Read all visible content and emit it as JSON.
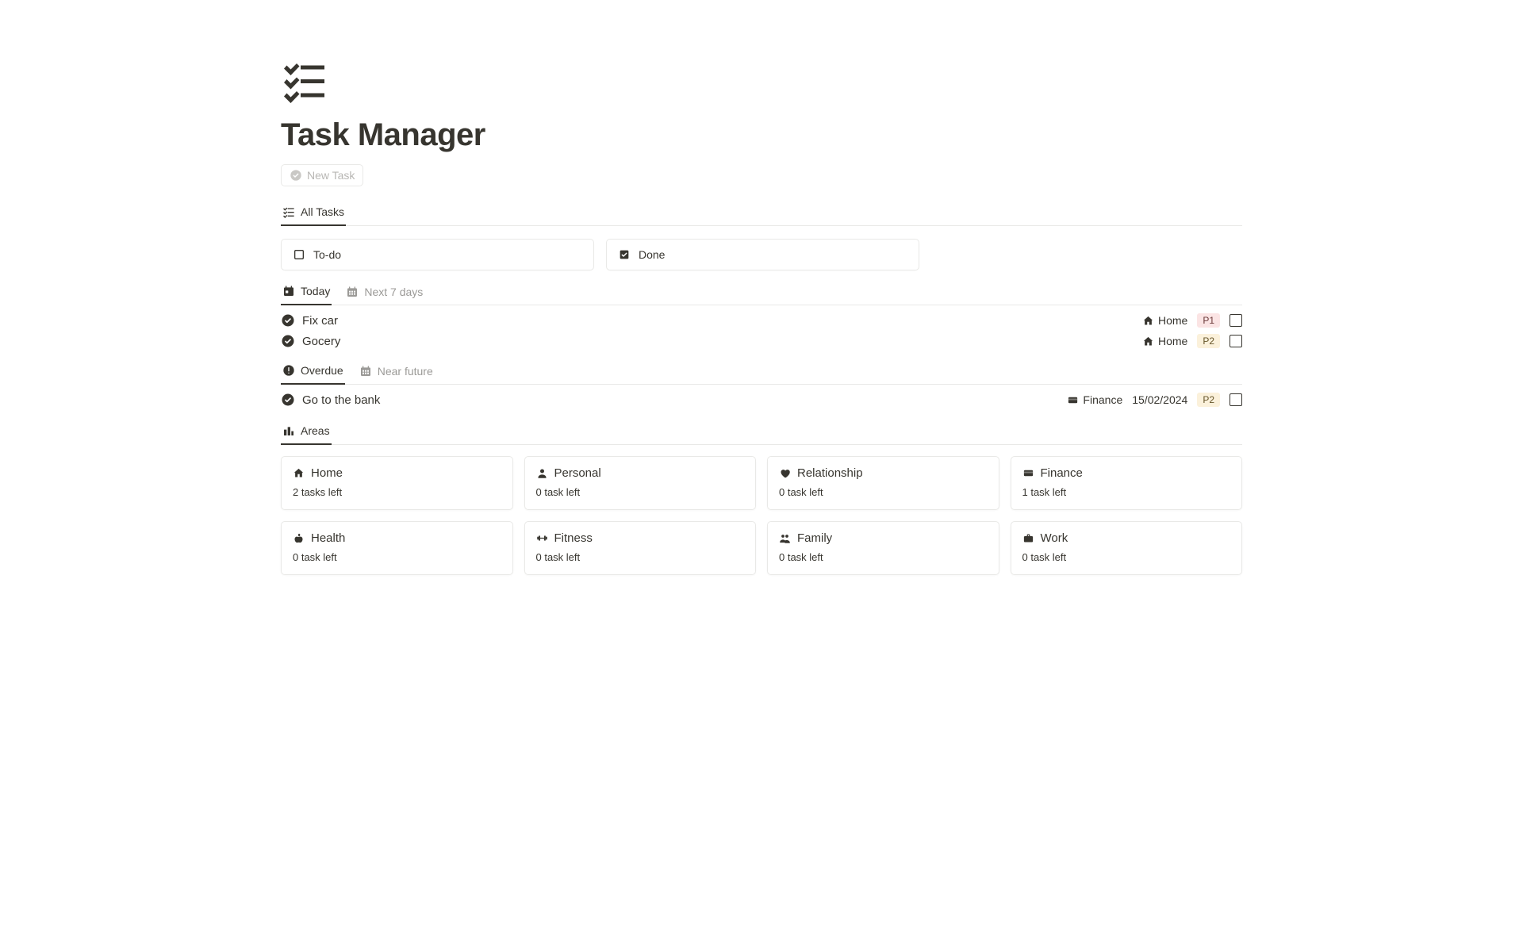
{
  "page": {
    "title": "Task Manager",
    "new_task_label": "New Task"
  },
  "all_tasks_tab": "All Tasks",
  "status": {
    "todo": "To-do",
    "done": "Done"
  },
  "today_tabs": {
    "today": "Today",
    "next7": "Next 7 days"
  },
  "today_tasks": [
    {
      "title": "Fix car",
      "area": "Home",
      "priority": "P1",
      "priority_class": "p1"
    },
    {
      "title": "Gocery",
      "area": "Home",
      "priority": "P2",
      "priority_class": "p2"
    }
  ],
  "overdue_tabs": {
    "overdue": "Overdue",
    "near_future": "Near future"
  },
  "overdue_tasks": [
    {
      "title": "Go to the bank",
      "area": "Finance",
      "date": "15/02/2024",
      "priority": "P2",
      "priority_class": "p2"
    }
  ],
  "areas_tab": "Areas",
  "areas": [
    {
      "name": "Home",
      "sub": "2 tasks left",
      "icon": "home"
    },
    {
      "name": "Personal",
      "sub": "0 task left",
      "icon": "person"
    },
    {
      "name": "Relationship",
      "sub": "0 task left",
      "icon": "heart"
    },
    {
      "name": "Finance",
      "sub": "1 task left",
      "icon": "card"
    },
    {
      "name": "Health",
      "sub": "0 task left",
      "icon": "apple"
    },
    {
      "name": "Fitness",
      "sub": "0 task left",
      "icon": "dumbbell"
    },
    {
      "name": "Family",
      "sub": "0 task left",
      "icon": "people"
    },
    {
      "name": "Work",
      "sub": "0 task left",
      "icon": "briefcase"
    }
  ]
}
